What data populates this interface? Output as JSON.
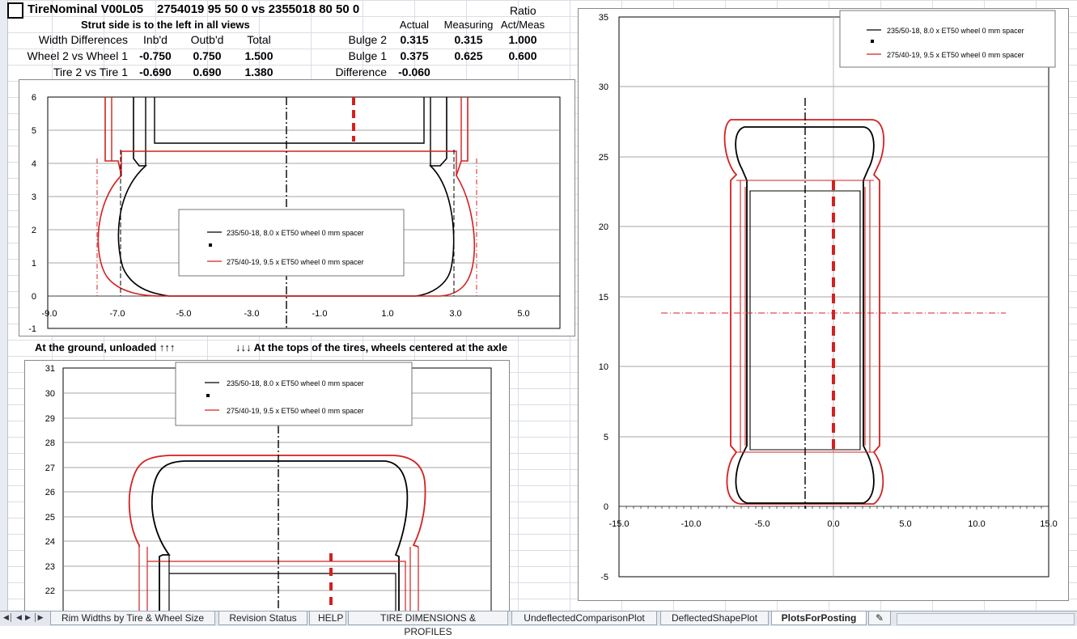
{
  "header": {
    "title": "TireNominal V00L05",
    "spec": "2754019 95 50 0 vs  2355018 80 50 0",
    "ratio_label": "Ratio",
    "strut_note": "Strut side is to the left in all views",
    "col_actual": "Actual",
    "col_measuring": "Measuring",
    "col_actmeas": "Act/Meas"
  },
  "width_table": {
    "heading": "Width Differences",
    "cols": [
      "Inb'd",
      "Outb'd",
      "Total"
    ],
    "rows": [
      {
        "label": "Wheel 2 vs Wheel 1",
        "values": [
          "-0.750",
          "0.750",
          "1.500"
        ]
      },
      {
        "label": "Tire 2 vs Tire 1",
        "values": [
          "-0.690",
          "0.690",
          "1.380"
        ]
      }
    ]
  },
  "bulge_table": {
    "rows": [
      {
        "label": "Bulge 2",
        "actual": "0.315",
        "measuring": "0.315",
        "ratio": "1.000"
      },
      {
        "label": "Bulge 1",
        "actual": "0.375",
        "measuring": "0.625",
        "ratio": "0.600"
      }
    ],
    "difference_label": "Difference",
    "difference_value": "-0.060"
  },
  "captions": {
    "ground": "At the ground, unloaded ↑↑↑",
    "tops": "↓↓↓ At the tops of the tires, wheels centered at the axle"
  },
  "legend": {
    "tire1": "235/50-18, 8.0 x ET50 wheel 0 mm spacer",
    "tire2": "275/40-19, 9.5 x ET50 wheel 0 mm spacer"
  },
  "colors": {
    "tire1": "#000000",
    "tire2": "#d42020"
  },
  "chart_data": [
    {
      "type": "line",
      "view": "ground",
      "xlim": [
        -9.0,
        6.0
      ],
      "ylim": [
        -1,
        6
      ],
      "x_ticks": [
        "-9.0",
        "-7.0",
        "-5.0",
        "-3.0",
        "-1.0",
        "1.0",
        "3.0",
        "5.0"
      ],
      "y_ticks": [
        "6",
        "5",
        "4",
        "3",
        "2",
        "1",
        "0",
        "-1"
      ],
      "series": [
        {
          "name": "235/50-18, 8.0 x ET50 wheel 0 mm spacer",
          "color": "#000000"
        },
        {
          "name": "275/40-19, 9.5 x ET50 wheel 0 mm spacer",
          "color": "#d42020"
        }
      ]
    },
    {
      "type": "line",
      "view": "top",
      "ylim": [
        21,
        31
      ],
      "y_ticks": [
        "31",
        "30",
        "29",
        "28",
        "27",
        "26",
        "25",
        "24",
        "23",
        "22"
      ],
      "series": [
        {
          "name": "235/50-18, 8.0 x ET50 wheel 0 mm spacer",
          "color": "#000000"
        },
        {
          "name": "275/40-19, 9.5 x ET50 wheel 0 mm spacer",
          "color": "#d42020"
        }
      ]
    },
    {
      "type": "line",
      "view": "full",
      "xlim": [
        -15.0,
        15.0
      ],
      "ylim": [
        -5,
        35
      ],
      "x_ticks": [
        "-15.0",
        "-10.0",
        "-5.0",
        "0.0",
        "5.0",
        "10.0",
        "15.0"
      ],
      "y_ticks": [
        "35",
        "30",
        "25",
        "20",
        "15",
        "10",
        "5",
        "0",
        "-5"
      ],
      "series": [
        {
          "name": "235/50-18, 8.0 x ET50 wheel 0 mm spacer",
          "color": "#000000"
        },
        {
          "name": "275/40-19, 9.5 x ET50 wheel 0 mm spacer",
          "color": "#d42020"
        }
      ]
    }
  ],
  "tabs": [
    {
      "label": "Rim Widths by Tire & Wheel Size",
      "active": false
    },
    {
      "label": "Revision Status",
      "active": false
    },
    {
      "label": "HELP",
      "active": false
    },
    {
      "label": "TIRE DIMENSIONS & PROFILES",
      "active": false
    },
    {
      "label": "UndeflectedComparisonPlot",
      "active": false
    },
    {
      "label": "DeflectedShapePlot",
      "active": false
    },
    {
      "label": "PlotsForPosting",
      "active": true
    }
  ]
}
